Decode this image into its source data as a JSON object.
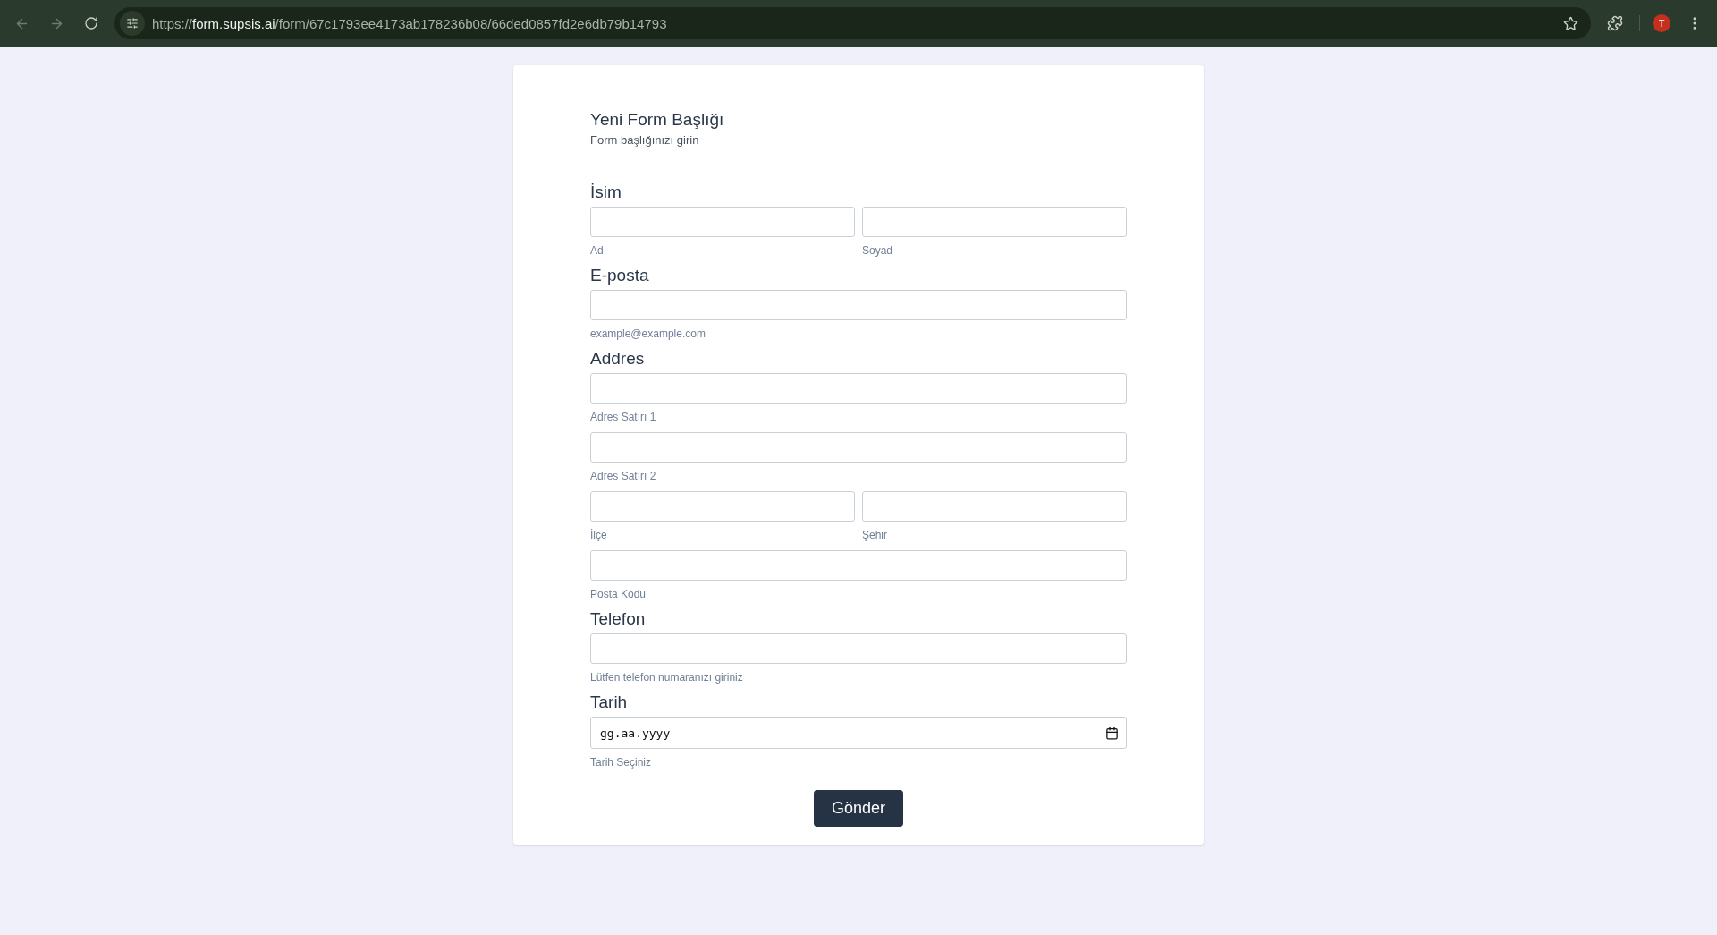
{
  "browser": {
    "url": "https://**form.supsis.ai**/form/67c1793ee4173ab178236b08/66ded0857fd2e6db79b14793",
    "profile_letter": "T"
  },
  "form": {
    "title": "Yeni Form Başlığı",
    "subtitle": "Form başlığınızı girin",
    "sections": [
      {
        "label": "İsim",
        "rows": [
          [
            {
              "kind": "text",
              "hint": "Ad"
            },
            {
              "kind": "text",
              "hint": "Soyad"
            }
          ]
        ]
      },
      {
        "label": "E-posta",
        "rows": [
          [
            {
              "kind": "text",
              "hint": "example@example.com"
            }
          ]
        ]
      },
      {
        "label": "Addres",
        "rows": [
          [
            {
              "kind": "text",
              "hint": "Adres Satırı 1"
            }
          ],
          [
            {
              "kind": "text",
              "hint": "Adres Satırı 2"
            }
          ],
          [
            {
              "kind": "text",
              "hint": "İlçe"
            },
            {
              "kind": "text",
              "hint": "Şehir"
            }
          ],
          [
            {
              "kind": "text",
              "hint": "Posta Kodu"
            }
          ]
        ]
      },
      {
        "label": "Telefon",
        "rows": [
          [
            {
              "kind": "text",
              "hint": "Lütfen telefon numaranızı giriniz"
            }
          ]
        ]
      },
      {
        "label": "Tarih",
        "rows": [
          [
            {
              "kind": "date",
              "placeholder": "gg.aa.yyyy",
              "hint": "Tarih Seçiniz"
            }
          ]
        ]
      }
    ],
    "submit": "Gönder"
  }
}
